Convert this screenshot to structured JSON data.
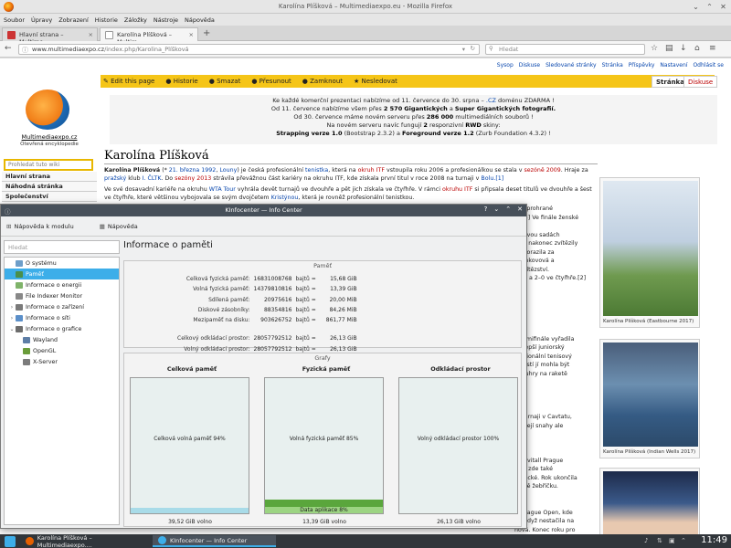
{
  "firefox": {
    "window_title": "Karolína Plíšková – Multimediaexpo.eu - Mozilla Firefox",
    "menu": [
      "Soubor",
      "Úpravy",
      "Zobrazení",
      "Historie",
      "Záložky",
      "Nástroje",
      "Nápověda"
    ],
    "tabs": [
      {
        "label": "Hlavní strana – Multime..."
      },
      {
        "label": "Karolína Plíšková – Multim..."
      }
    ],
    "url_prefix": "www.multimediaexpo.cz",
    "url_path": "/index.php/Karolina_Plíšková",
    "search_placeholder": "Hledat"
  },
  "wiki": {
    "top_links": [
      "Sysop",
      "Diskuse",
      "Sledované stránky",
      "Stránka",
      "Příspěvky",
      "Nastavení",
      "Odhlásit se"
    ],
    "logo_title": "Multimediaexpo.cz",
    "logo_subtitle": "Otevřená encyklopedie",
    "search_placeholder": "Prohledat tuto wiki",
    "nav": [
      "Hlavní strana",
      "Náhodná stránka",
      "Společenství"
    ],
    "actions": [
      "Edit this page",
      "Historie",
      "Smazat",
      "Přesunout",
      "Zamknout",
      "Nesledovat"
    ],
    "tab_page": "Stránka",
    "tab_talk": "Diskuse",
    "notice": {
      "l1a": "Ke každé komerční prezentaci nabízíme od 11. července do 30. srpna – ",
      "l1b": ".CZ",
      "l1c": " doménu ZDARMA !",
      "l2a": "Od 11. července nabízíme všem přes ",
      "l2b": "2 570",
      "l2c": "Gigantických",
      "l2d": " a ",
      "l2e": "Super Gigantických",
      "l2f": " fotografií.",
      "l3a": "Od 30. července máme novém serveru přes ",
      "l3b": "286 000",
      "l3c": " multimediálních souborů !",
      "l4a": "Na novém serveru navíc fungují ",
      "l4b": "2",
      "l4c": " responzivní ",
      "l4d": "RWD",
      "l4e": " skiny:",
      "l5a": "Strapping verze 1.0",
      "l5b": " (Bootstrap 2.3.2) a ",
      "l5c": "Foreground verze 1.2",
      "l5d": " (Zurb Foundation 4.3.2) !"
    },
    "heading": "Karolína Plíšková",
    "p1a": "Karolína Plíšková",
    "p1b": " (* ",
    "p1c": "21. března 1992",
    "p1d": ", ",
    "p1e": "Louny",
    "p1f": ") je česká profesionální ",
    "p1g": "tenistka",
    "p1h": ", která na ",
    "p1i": "okruh ITF",
    "p1j": " vstoupila roku 2006 a profesionálkou se stala v ",
    "p1k": "sezóně 2009",
    "p1l": ". Hraje za ",
    "p1m": "pražský",
    "p1n": " klub ",
    "p1o": "I. ČLTK",
    "p1p": ". Do ",
    "p1q": "sezóny 2013",
    "p1r": " strávila převážnou část kariéry na okruhu ITF, kde získala první titul v roce 2008 na turnaji v ",
    "p1s": "Bolu",
    "p1t": ".[1]",
    "p2a": "Ve své dosavadní kariéře na okruhu ",
    "p2b": "WTA Tour",
    "p2c": " vyhrála devět turnajů ve dvouhře a pět jich získala ve čtyřhře. V rámci ",
    "p2d": "okruhu ITF",
    "p2e": " si připsala deset titulů ve dvouhře a šest ve čtyřhře, které většinou vybojovala se svým dvojčetem ",
    "p2f": "Kristýnou",
    "p2g": ", která je rovněž profesionální tenistkou.",
    "right_lines": [
      "ý je prohrané",
      "-6.[3] Ve finále ženské",
      "ES]",
      "ve dvou sadách",
      "sérii nakonec zvítězily",
      "ak porazila za",
      "učenkovová a",
      "vé vítězství.",
      "yhře a 2–0 ve čtyřhře.[2]",
      "",
      "",
      "",
      "",
      "",
      "",
      "v semifinále vyřadila",
      "nejlepší juniorský",
      "ofesionální tenisový",
      "oplastí jí mohla být",
      "dvouhry na raketě",
      "",
      "",
      "",
      "",
      "m turnaji v Cavtatu,",
      "en. Její snahy ale",
      "",
      "",
      "",
      "CNGvitall Prague",
      "n se zde také",
      "radecké. Rok ukončila",
      "místě žebříčku.",
      "",
      "",
      "M Prague Open, kde",
      "te, když nestačila na",
      "nová. Konec roku pro"
    ],
    "captions": [
      "Karolína Plíšková (Eastbourne 2017)",
      "Karolína Plíšková (Indian Wells 2017)"
    ]
  },
  "kinfocenter": {
    "window_title": "KInfocenter — Info Center",
    "toolbar": [
      "Nápověda k modulu",
      "Nápověda"
    ],
    "search_placeholder": "Hledat",
    "tree": [
      {
        "label": "O systému",
        "level": 0,
        "arrow": "",
        "selected": false
      },
      {
        "label": "Paměť",
        "level": 0,
        "arrow": "",
        "selected": true
      },
      {
        "label": "Informace o energii",
        "level": 0,
        "arrow": "",
        "selected": false
      },
      {
        "label": "File Indexer Monitor",
        "level": 0,
        "arrow": "",
        "selected": false
      },
      {
        "label": "Informace o zařízení",
        "level": 0,
        "arrow": "›",
        "selected": false
      },
      {
        "label": "Informace o síti",
        "level": 0,
        "arrow": "›",
        "selected": false
      },
      {
        "label": "Informace o grafice",
        "level": 0,
        "arrow": "⌄",
        "selected": false
      },
      {
        "label": "Wayland",
        "level": 1,
        "arrow": "",
        "selected": false
      },
      {
        "label": "OpenGL",
        "level": 1,
        "arrow": "",
        "selected": false
      },
      {
        "label": "X-Server",
        "level": 1,
        "arrow": "",
        "selected": false
      }
    ],
    "heading": "Informace o paměti",
    "memory_group_title": "Paměť",
    "memory_rows": [
      {
        "label": "Celková fyzická paměť:",
        "bytes": "16831008768",
        "unit": "bajtů =",
        "value": "15,68 GiB"
      },
      {
        "label": "Volná fyzická paměť:",
        "bytes": "14379810816",
        "unit": "bajtů =",
        "value": "13,39 GiB"
      },
      {
        "label": "Sdílená paměť:",
        "bytes": "20975616",
        "unit": "bajtů =",
        "value": "20,00 MiB"
      },
      {
        "label": "Diskové zásobníky:",
        "bytes": "88354816",
        "unit": "bajtů =",
        "value": "84,26 MiB"
      },
      {
        "label": "Mezipaměť na disku:",
        "bytes": "903626752",
        "unit": "bajtů =",
        "value": "861,77 MiB"
      },
      {
        "label": "",
        "bytes": "",
        "unit": "",
        "value": ""
      },
      {
        "label": "Celkový odkládací prostor:",
        "bytes": "28057792512",
        "unit": "bajtů =",
        "value": "26,13 GiB"
      },
      {
        "label": "Volný odkládací prostor:",
        "bytes": "28057792512",
        "unit": "bajtů =",
        "value": "26,13 GiB"
      }
    ],
    "graphs_title": "Grafy",
    "graphs": [
      {
        "title": "Celková paměť",
        "label": "Celková volná paměť 94%",
        "fill_label": "",
        "fill_fraction": 0.04,
        "fill_color": "#a8dbe8",
        "free": "39,52 GiB volno"
      },
      {
        "title": "Fyzická paměť",
        "label": "Volná fyzická paměť 85%",
        "fill_label": "Data aplikace 8%",
        "fill_fraction": 0.1,
        "fill_color": "#9cd482",
        "free": "13,39 GiB volno"
      },
      {
        "title": "Odkládací prostor",
        "label": "Volný odkládací prostor 100%",
        "fill_label": "",
        "fill_fraction": 0,
        "fill_color": "#a8dbe8",
        "free": "26,13 GiB volno"
      }
    ]
  },
  "taskbar": {
    "items": [
      "Karolína Plíšková – Multimediaexpo....",
      "KInfocenter — Info Center"
    ],
    "clock": "11:49"
  },
  "colors": {
    "wiki_action_bar": "#f5c518",
    "link": "#0645ad",
    "selection": "#3daee9",
    "kde_title": "#47505a"
  }
}
